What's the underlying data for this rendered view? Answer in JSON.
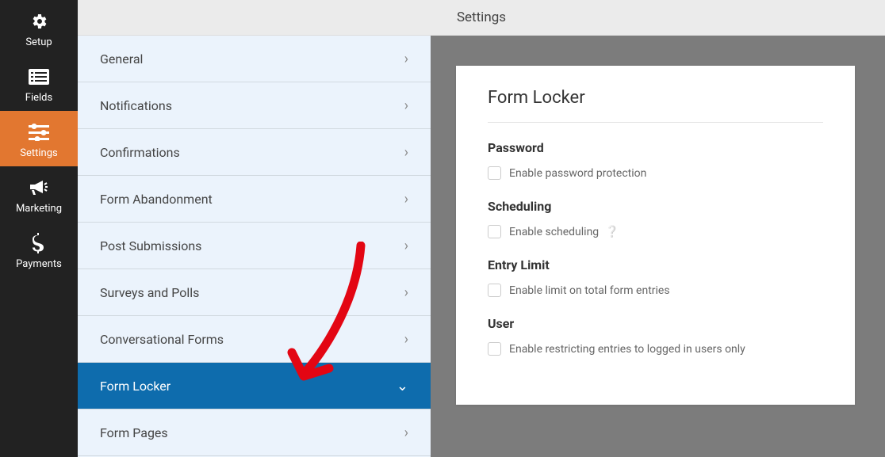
{
  "nav": [
    {
      "label": "Setup",
      "icon": "gear"
    },
    {
      "label": "Fields",
      "icon": "list"
    },
    {
      "label": "Settings",
      "icon": "sliders",
      "active": true
    },
    {
      "label": "Marketing",
      "icon": "bullhorn"
    },
    {
      "label": "Payments",
      "icon": "dollar"
    }
  ],
  "topbar": {
    "title": "Settings"
  },
  "menu": {
    "items": [
      {
        "label": "General"
      },
      {
        "label": "Notifications"
      },
      {
        "label": "Confirmations"
      },
      {
        "label": "Form Abandonment"
      },
      {
        "label": "Post Submissions"
      },
      {
        "label": "Surveys and Polls"
      },
      {
        "label": "Conversational Forms"
      },
      {
        "label": "Form Locker",
        "selected": true
      },
      {
        "label": "Form Pages"
      }
    ]
  },
  "panel": {
    "title": "Form Locker",
    "sections": {
      "password": {
        "heading": "Password",
        "checkbox": "Enable password protection"
      },
      "scheduling": {
        "heading": "Scheduling",
        "checkbox": "Enable scheduling"
      },
      "entry_limit": {
        "heading": "Entry Limit",
        "checkbox": "Enable limit on total form entries"
      },
      "user": {
        "heading": "User",
        "checkbox": "Enable restricting entries to logged in users only"
      }
    }
  }
}
